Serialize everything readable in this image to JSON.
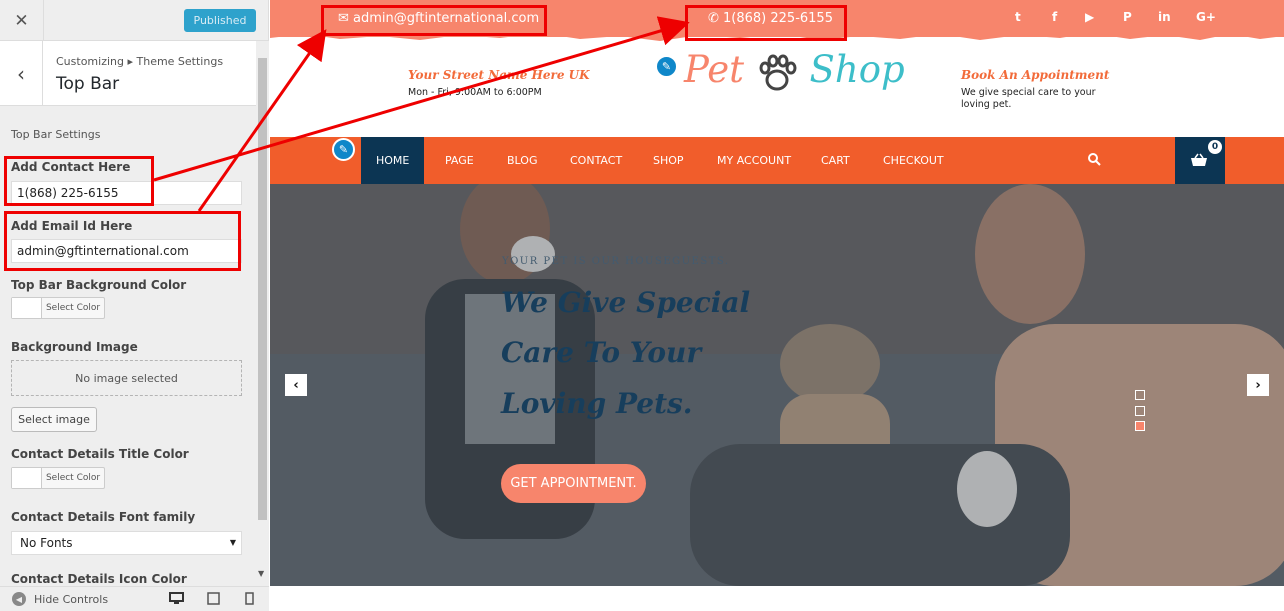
{
  "customizer": {
    "publish_label": "Published",
    "breadcrumb": "Customizing ▸ Theme Settings",
    "section_title": "Top Bar",
    "group_title": "Top Bar Settings",
    "controls": {
      "contact_label": "Add Contact Here",
      "contact_value": "1(868) 225-6155",
      "email_label": "Add Email Id Here",
      "email_value": "admin@gftinternational.com",
      "bg_color_label": "Top Bar Background Color",
      "select_color_label": "Select Color",
      "bg_image_label": "Background Image",
      "no_image_text": "No image selected",
      "select_image_label": "Select image",
      "title_color_label": "Contact Details Title Color",
      "font_family_label": "Contact Details Font family",
      "font_family_value": "No Fonts",
      "icon_color_label": "Contact Details Icon Color"
    },
    "footer": {
      "hide_controls_label": "Hide Controls"
    }
  },
  "preview": {
    "topbar": {
      "email": "admin@gftinternational.com",
      "phone": "1(868) 225-6155",
      "social_icons": [
        "twitter-icon",
        "facebook-icon",
        "youtube-icon",
        "pinterest-icon",
        "linkedin-icon",
        "google-plus-icon"
      ]
    },
    "header": {
      "address_title": "Your Street Name Here UK",
      "address_sub": "Mon - Fri, 9:00AM to 6:00PM",
      "logo_part1": "Pet",
      "logo_part2": "Shop",
      "appointment_title": "Book An Appointment",
      "appointment_sub": "We give special care to your loving pet."
    },
    "nav": {
      "items": [
        "HOME",
        "PAGE",
        "BLOG",
        "CONTACT",
        "SHOP",
        "MY ACCOUNT",
        "CART",
        "CHECKOUT"
      ],
      "cart_count": "0"
    },
    "hero": {
      "tagline": "YOUR PET IS OUR HOUSEGUESTS.",
      "heading_lines": [
        "We Give Special",
        "Care To Your",
        "Loving Pets."
      ],
      "button_label": "GET APPOINTMENT."
    },
    "colors": {
      "topbar": "#f7856c",
      "nav": "#f15d2b",
      "nav_active": "#0c3553",
      "annotation": "#ee0000"
    }
  }
}
